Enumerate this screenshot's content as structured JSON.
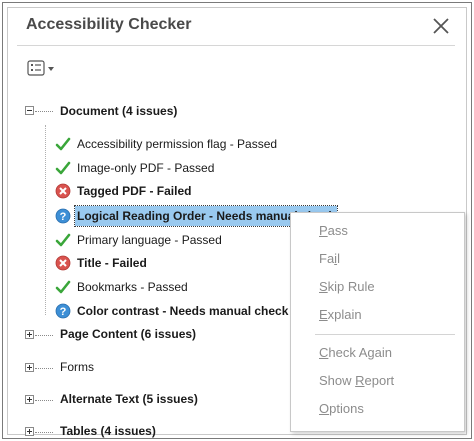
{
  "panel": {
    "title": "Accessibility Checker"
  },
  "tree": {
    "document": {
      "label": "Document (4 issues)",
      "items": [
        {
          "text": "Accessibility permission flag - Passed",
          "status": "passed",
          "icon": "check-icon"
        },
        {
          "text": "Image-only PDF - Passed",
          "status": "passed",
          "icon": "check-icon"
        },
        {
          "text": "Tagged PDF - Failed",
          "status": "failed",
          "icon": "failed-icon"
        },
        {
          "text": "Logical Reading Order - Needs manual check",
          "status": "manual",
          "icon": "question-icon"
        },
        {
          "text": "Primary language - Passed",
          "status": "passed",
          "icon": "check-icon"
        },
        {
          "text": "Title - Failed",
          "status": "failed",
          "icon": "failed-icon"
        },
        {
          "text": "Bookmarks - Passed",
          "status": "passed",
          "icon": "check-icon"
        },
        {
          "text": "Color contrast - Needs manual check",
          "status": "manual",
          "icon": "question-icon"
        }
      ]
    },
    "categories": [
      {
        "label": "Page Content (6 issues)"
      },
      {
        "label": "Forms"
      },
      {
        "label": "Alternate Text (5 issues)"
      },
      {
        "label": "Tables (4 issues)"
      }
    ]
  },
  "context_menu": {
    "items": [
      {
        "label": "Pass",
        "mnemonic": "P"
      },
      {
        "label": "Fail",
        "mnemonic": "i"
      },
      {
        "label": "Skip Rule",
        "mnemonic": "S"
      },
      {
        "label": "Explain",
        "mnemonic": "E"
      },
      {
        "label": "Check Again",
        "mnemonic": "C"
      },
      {
        "label": "Show Report",
        "mnemonic": "R"
      },
      {
        "label": "Options",
        "mnemonic": "O"
      }
    ]
  },
  "colors": {
    "passed": "#3aa63a",
    "failed": "#d9534f",
    "manual": "#3d8fd6",
    "selection": "#99c9ef"
  }
}
